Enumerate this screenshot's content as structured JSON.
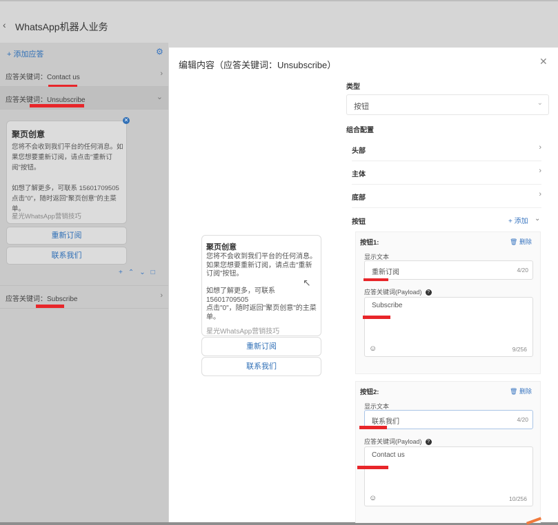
{
  "header": {
    "title": "WhatsApp机器人业务",
    "back_icon": "chevron-left-icon"
  },
  "left": {
    "add_reply": "+ 添加应答",
    "keywords": [
      {
        "label": "应答关键词：Contact us"
      },
      {
        "label": "应答关键词：Unsubscribe"
      },
      {
        "label": "应答关键词：Subscribe"
      }
    ],
    "card": {
      "title": "聚页创意",
      "body": "您将不会收到我们平台的任何消息。如果您想要重新订阅，请点击\"重新订阅\"按钮。\n\n如想了解更多，可联系 15601709505点击\"0\"，随时返回\"聚页创意\"的主菜单。",
      "footer": "星光WhatsApp营销技巧"
    },
    "buttons": [
      "重新订阅",
      "联系我们"
    ]
  },
  "modal": {
    "title": "编辑内容（应答关键词：Unsubscribe）",
    "preview": {
      "title": "聚页创意",
      "body": "您将不会收到我们平台的任何消息。如果您想要重新订阅，请点击\"重新订阅\"按钮。\n\n如想了解更多，可联系15601709505\n点击\"0\"，随时返回\"聚页创意\"的主菜单。",
      "footer": "星光WhatsApp营销技巧",
      "buttons": [
        "重新订阅",
        "联系我们"
      ]
    },
    "type_label": "类型",
    "type_value": "按钮",
    "combo_label": "组合配置",
    "combo_rows": [
      "头部",
      "主体",
      "底部"
    ],
    "buttons_label": "按钮",
    "add_label": "+ 添加",
    "button_items": [
      {
        "header": "按钮1:",
        "delete": "删除",
        "display_label": "显示文本",
        "display_value": "重新订阅",
        "display_count": "4/20",
        "payload_label": "应答关键词(Payload)",
        "payload_value": "Subscribe",
        "payload_count": "9/256"
      },
      {
        "header": "按钮2:",
        "delete": "删除",
        "display_label": "显示文本",
        "display_value": "联系我们",
        "display_count": "4/20",
        "payload_label": "应答关键词(Payload)",
        "payload_value": "Contact us",
        "payload_count": "10/256"
      }
    ]
  },
  "colors": {
    "accent": "#2f6fb6",
    "redline": "#e8262a"
  }
}
